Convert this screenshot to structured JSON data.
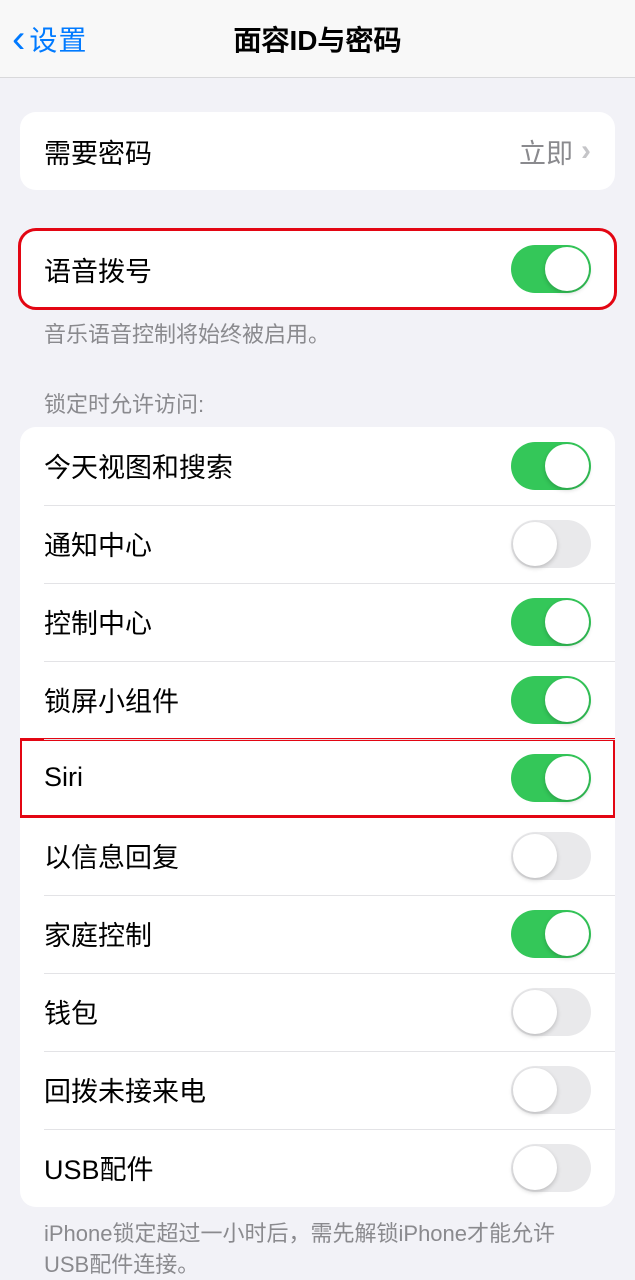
{
  "nav": {
    "back_label": "设置",
    "title": "面容ID与密码"
  },
  "passcode": {
    "label": "需要密码",
    "value": "立即"
  },
  "voice_dial": {
    "label": "语音拨号",
    "on": true,
    "footer": "音乐语音控制将始终被启用。"
  },
  "locked_header": "锁定时允许访问:",
  "locked": {
    "items": [
      {
        "label": "今天视图和搜索",
        "on": true
      },
      {
        "label": "通知中心",
        "on": false
      },
      {
        "label": "控制中心",
        "on": true
      },
      {
        "label": "锁屏小组件",
        "on": true
      },
      {
        "label": "Siri",
        "on": true
      },
      {
        "label": "以信息回复",
        "on": false
      },
      {
        "label": "家庭控制",
        "on": true
      },
      {
        "label": "钱包",
        "on": false
      },
      {
        "label": "回拨未接来电",
        "on": false
      },
      {
        "label": "USB配件",
        "on": false
      }
    ],
    "footer": "iPhone锁定超过一小时后，需先解锁iPhone才能允许USB配件连接。"
  }
}
